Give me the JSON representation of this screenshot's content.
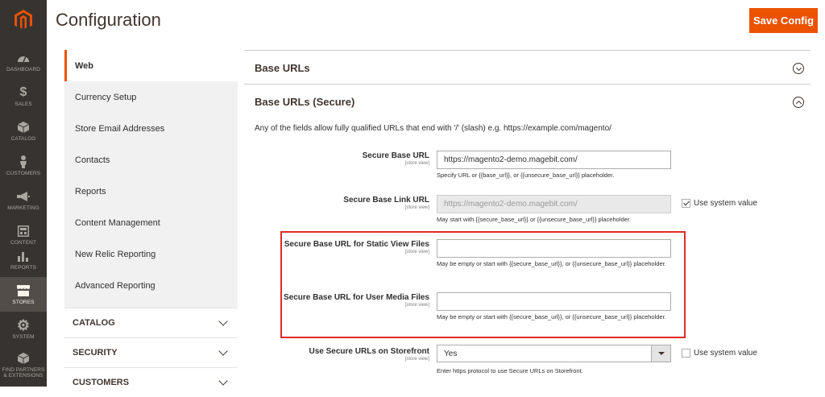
{
  "colors": {
    "accent": "#eb5202",
    "menu_bg": "#373330",
    "highlight": "#e02b27"
  },
  "header": {
    "title": "Configuration",
    "save_label": "Save Config"
  },
  "menu": [
    {
      "label": "DASHBOARD",
      "icon": "speedometer-icon"
    },
    {
      "label": "SALES",
      "icon": "dollar-icon"
    },
    {
      "label": "CATALOG",
      "icon": "cube-icon"
    },
    {
      "label": "CUSTOMERS",
      "icon": "person-icon"
    },
    {
      "label": "MARKETING",
      "icon": "megaphone-icon"
    },
    {
      "label": "CONTENT",
      "icon": "layout-icon"
    },
    {
      "label": "REPORTS",
      "icon": "bar-chart-icon"
    },
    {
      "label": "STORES",
      "icon": "storefront-icon"
    },
    {
      "label": "SYSTEM",
      "icon": "gear-icon"
    },
    {
      "label": "FIND PARTNERS & EXTENSIONS",
      "icon": "extensions-icon"
    }
  ],
  "tabs": {
    "items": [
      "Web",
      "Currency Setup",
      "Store Email Addresses",
      "Contacts",
      "Reports",
      "Content Management",
      "New Relic Reporting",
      "Advanced Reporting"
    ],
    "groups": [
      "CATALOG",
      "SECURITY",
      "CUSTOMERS"
    ]
  },
  "main": {
    "section1": "Base URLs",
    "section2": "Base URLs (Secure)",
    "intro": "Any of the fields allow fully qualified URLs that end with '/' (slash) e.g. https://example.com/magento/",
    "scope": "[store view]",
    "use_system": "Use system value",
    "fields": {
      "secure_base_url": {
        "label": "Secure Base URL",
        "value": "https://magento2-demo.magebit.com/",
        "note": "Specify URL or {{base_url}}, or {{unsecure_base_url}} placeholder."
      },
      "secure_base_link_url": {
        "label": "Secure Base Link URL",
        "value": "https://magento2-demo.magebit.com/",
        "note": "May start with {{secure_base_url}} or {{unsecure_base_url}} placeholder."
      },
      "static_view": {
        "label": "Secure Base URL for Static View Files",
        "value": "",
        "note": "May be empty or start with {{secure_base_url}}, or {{unsecure_base_url}} placeholder."
      },
      "user_media": {
        "label": "Secure Base URL for User Media Files",
        "value": "",
        "note": "May be empty or start with {{secure_base_url}}, or {{unsecure_base_url}} placeholder."
      },
      "use_secure_storefront": {
        "label": "Use Secure URLs on Storefront",
        "value": "Yes",
        "note": "Enter https protocol to use Secure URLs on Storefront."
      }
    }
  }
}
